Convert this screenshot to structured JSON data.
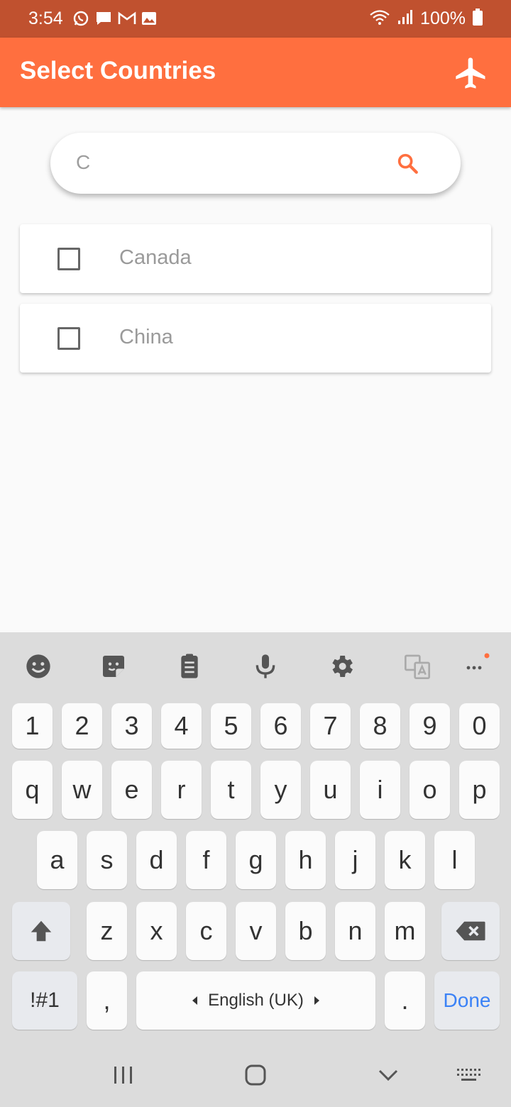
{
  "status_bar": {
    "time": "3:54",
    "battery": "100%",
    "icons": [
      "whatsapp-icon",
      "message-icon",
      "gmail-icon",
      "gallery-icon",
      "wifi-icon",
      "signal-icon",
      "battery-icon"
    ]
  },
  "app_bar": {
    "title": "Select Countries",
    "action_icon": "airplane-icon"
  },
  "search": {
    "value": "C",
    "icon": "search-icon"
  },
  "countries": [
    {
      "name": "Canada",
      "checked": false
    },
    {
      "name": "China",
      "checked": false
    }
  ],
  "keyboard": {
    "toolbar_icons": [
      "emoji-icon",
      "sticker-icon",
      "clipboard-icon",
      "mic-icon",
      "settings-icon",
      "translate-icon",
      "more-icon"
    ],
    "row_numbers": [
      "1",
      "2",
      "3",
      "4",
      "5",
      "6",
      "7",
      "8",
      "9",
      "0"
    ],
    "row1": [
      "q",
      "w",
      "e",
      "r",
      "t",
      "y",
      "u",
      "i",
      "o",
      "p"
    ],
    "row2": [
      "a",
      "s",
      "d",
      "f",
      "g",
      "h",
      "j",
      "k",
      "l"
    ],
    "row3": [
      "z",
      "x",
      "c",
      "v",
      "b",
      "n",
      "m"
    ],
    "symbols_label": "!#1",
    "comma_label": ",",
    "space_label": "English (UK)",
    "period_label": ".",
    "done_label": "Done"
  },
  "colors": {
    "status_bar": "#c0512f",
    "app_bar": "#ff6f3f",
    "accent": "#ff6f3f",
    "done": "#3b82f6"
  }
}
